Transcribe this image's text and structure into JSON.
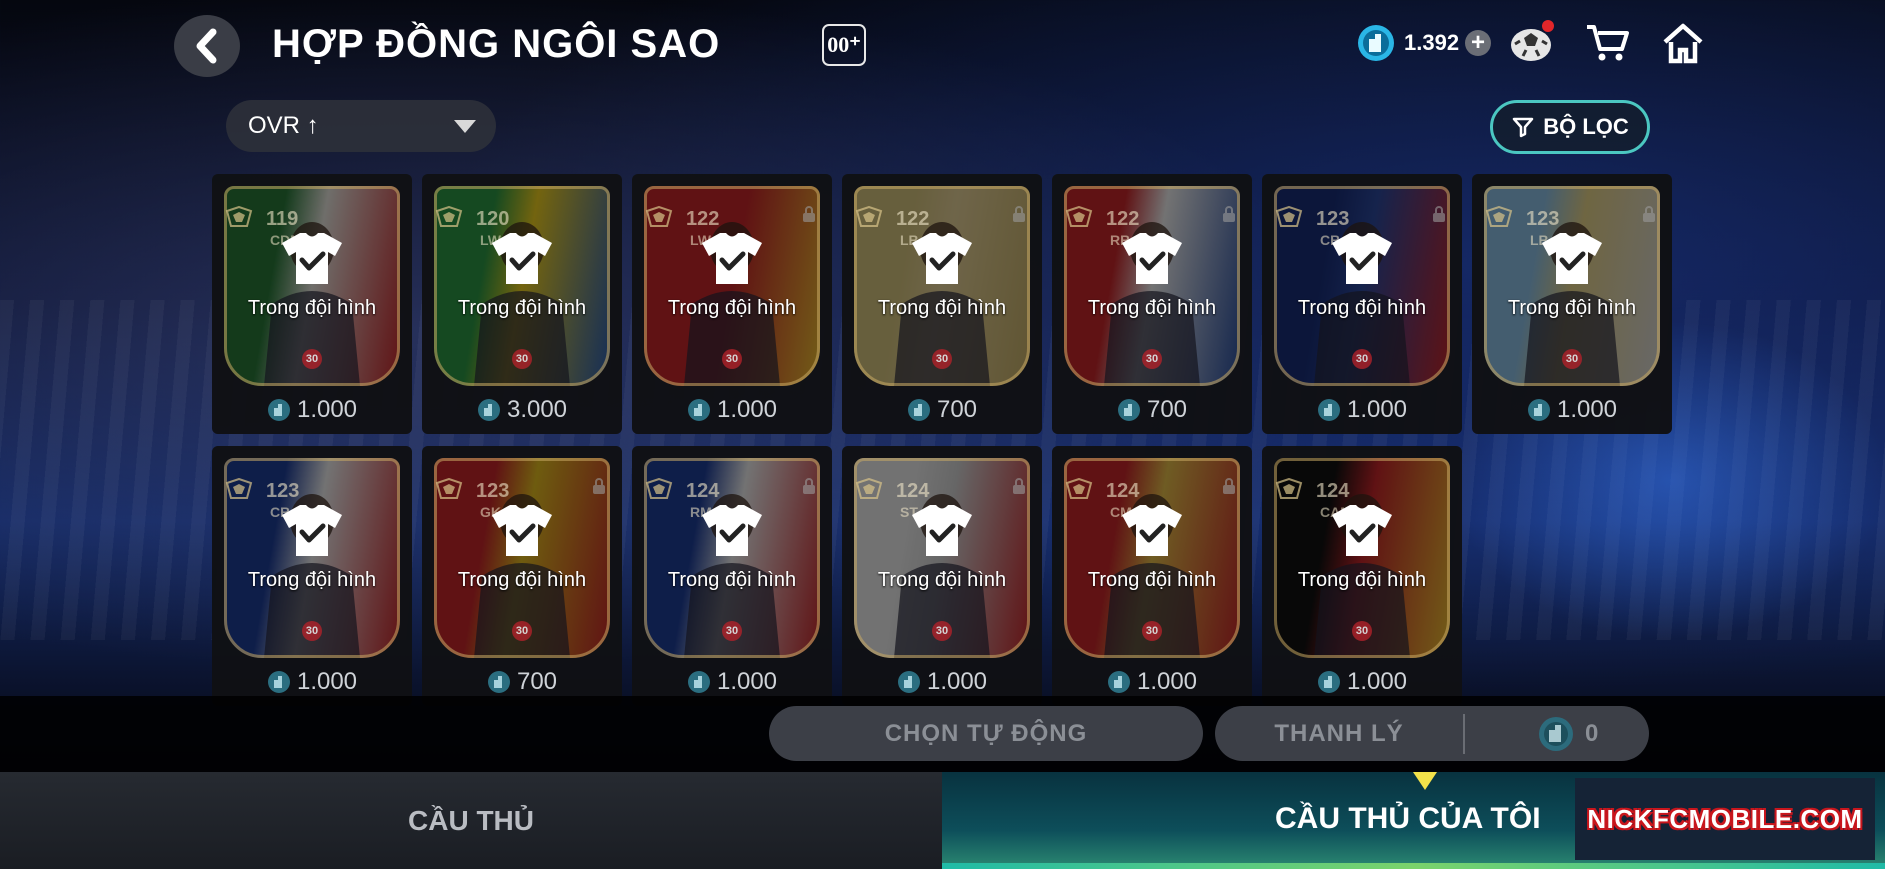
{
  "header": {
    "title": "HỢP ĐỒNG NGÔI SAO",
    "title_badge": "00⁺",
    "coin_amount": "1.392"
  },
  "toolbar": {
    "sort_label": "OVR ↑",
    "filter_label": "BỘ LỌC"
  },
  "lineup_label": "Trong đội hình",
  "cards": [
    {
      "ovr": "119",
      "position": "CDM",
      "price": "1.000",
      "level": "30",
      "colors": [
        "#2a7a3a",
        "#e9e6df",
        "#c8262a"
      ],
      "locked": false
    },
    {
      "ovr": "120",
      "position": "LW",
      "price": "3.000",
      "level": "30",
      "colors": [
        "#2d9a45",
        "#f1d120",
        "#2a5fb8"
      ],
      "locked": false
    },
    {
      "ovr": "122",
      "position": "LW",
      "price": "1.000",
      "level": "30",
      "colors": [
        "#c8262a",
        "#c8262a",
        "#f1c232"
      ],
      "locked": true
    },
    {
      "ovr": "122",
      "position": "LB",
      "price": "700",
      "level": "30",
      "colors": [
        "#d8c680",
        "#e8d49a",
        "#c9b26a"
      ],
      "locked": true
    },
    {
      "ovr": "122",
      "position": "RB",
      "price": "700",
      "level": "30",
      "colors": [
        "#c8262a",
        "#f0f0f0",
        "#2a4fa0"
      ],
      "locked": true
    },
    {
      "ovr": "123",
      "position": "CB",
      "price": "1.000",
      "level": "30",
      "colors": [
        "#1a2f7a",
        "#2d4aa0",
        "#c8262a"
      ],
      "locked": true
    },
    {
      "ovr": "123",
      "position": "LB",
      "price": "1.000",
      "level": "30",
      "colors": [
        "#8fc3e8",
        "#e8d58a",
        "#d9d9d9"
      ],
      "locked": true
    },
    {
      "ovr": "123",
      "position": "CB",
      "price": "1.000",
      "level": "30",
      "colors": [
        "#1f3f9a",
        "#f0f0f0",
        "#c8262a"
      ],
      "locked": false
    },
    {
      "ovr": "123",
      "position": "GK",
      "price": "700",
      "level": "30",
      "colors": [
        "#c8262a",
        "#e6c021",
        "#c8262a"
      ],
      "locked": true
    },
    {
      "ovr": "124",
      "position": "RM",
      "price": "1.000",
      "level": "30",
      "colors": [
        "#1f3f9a",
        "#f0f0f0",
        "#c8262a"
      ],
      "locked": true
    },
    {
      "ovr": "124",
      "position": "ST",
      "price": "1.000",
      "level": "30",
      "colors": [
        "#efefef",
        "#d6d6d6",
        "#c8262a"
      ],
      "locked": true
    },
    {
      "ovr": "124",
      "position": "CM",
      "price": "1.000",
      "level": "30",
      "colors": [
        "#c8262a",
        "#e8c04a",
        "#c8262a"
      ],
      "locked": true
    },
    {
      "ovr": "124",
      "position": "CAM",
      "price": "1.000",
      "level": "30",
      "colors": [
        "#111111",
        "#c8262a",
        "#f1c232"
      ],
      "locked": false
    }
  ],
  "actions": {
    "auto_select": "CHỌN TỰ ĐỘNG",
    "sell": "THANH LÝ",
    "sell_count": "0"
  },
  "tabs": {
    "players": "CẦU THỦ",
    "my_players": "CẦU THỦ CỦA TÔI"
  },
  "watermark": "NICKFCMOBILE.COM",
  "colors": {
    "accent_teal": "#4bc7c1",
    "coin_blue": "#2ab6e6",
    "active_tab_arrow": "#f3e24a",
    "notification": "#e2262a"
  }
}
